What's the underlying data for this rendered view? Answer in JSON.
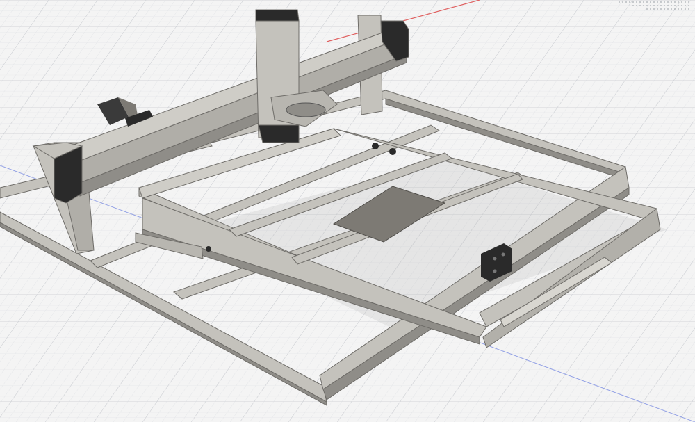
{
  "viewport": {
    "background": "#f4f4f4",
    "grid_major_color": "#c9ccd1",
    "grid_minor_color": "#e2e4e7",
    "axis_x_color": "#e06060",
    "axis_y_color": "#6b7fe0"
  },
  "model": {
    "extrusion_color": "#c4c2bc",
    "extrusion_slot_color": "#8f8d88",
    "extrusion_edge_color": "#6e6c68",
    "bracket_color": "#2a2a2a",
    "plate_color": "#7d7a74",
    "motor_color": "#3a3a3a"
  },
  "view_cube": {
    "icon": "view-cube-dots-icon"
  }
}
